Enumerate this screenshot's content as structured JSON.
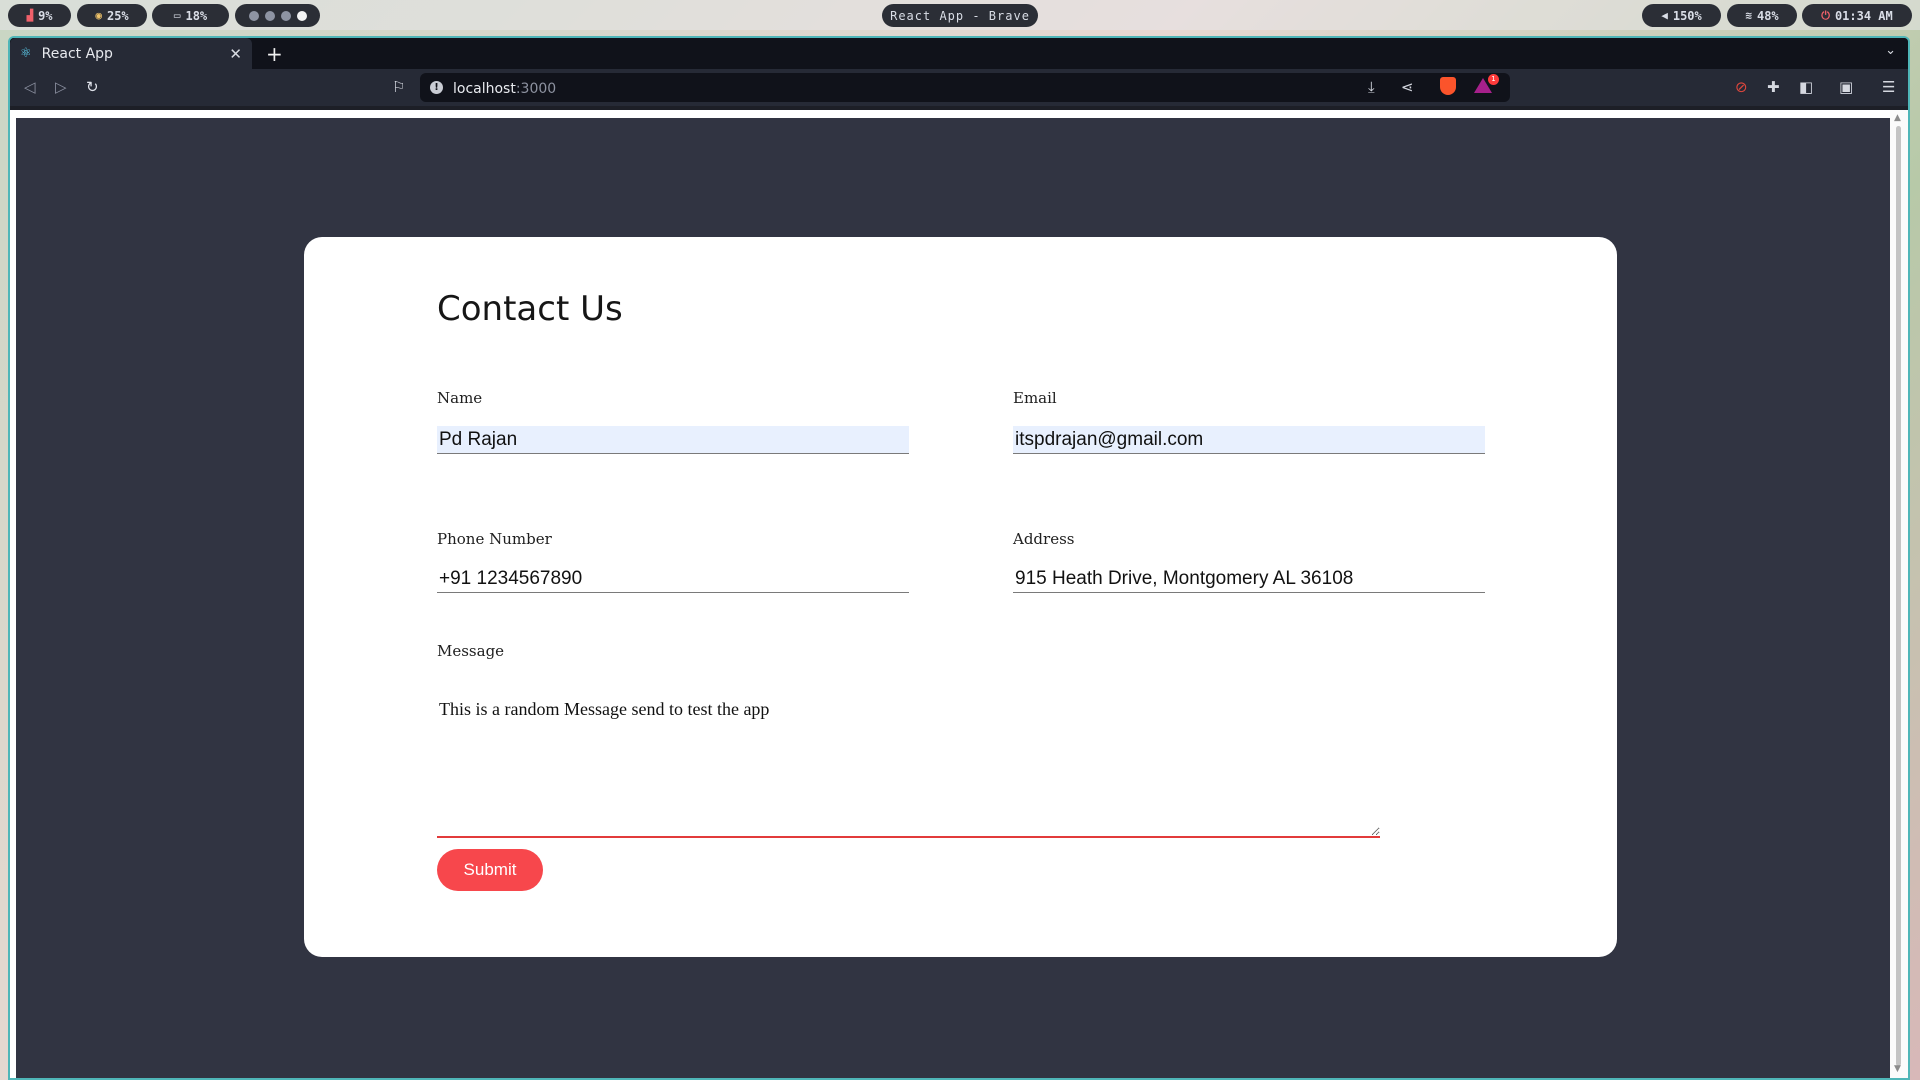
{
  "system_bar": {
    "cpu": "9%",
    "memory": "25%",
    "disk": "18%",
    "workspaces": [
      false,
      false,
      false,
      true
    ],
    "window_title": "React App - Brave",
    "volume": "150%",
    "wifi": "48%",
    "clock": "01:34 AM"
  },
  "browser": {
    "tab": {
      "title": "React App"
    },
    "address": {
      "host": "localhost",
      "port": ":3000"
    },
    "rewards_badge": "1"
  },
  "form": {
    "title": "Contact Us",
    "name": {
      "label": "Name",
      "value": "Pd Rajan"
    },
    "email": {
      "label": "Email",
      "value": "itspdrajan@gmail.com"
    },
    "phone": {
      "label": "Phone Number",
      "value": "+91 1234567890"
    },
    "address": {
      "label": "Address",
      "value": "915 Heath Drive, Montgomery AL 36108"
    },
    "message": {
      "label": "Message",
      "value": "This is a random Message send to test the app"
    },
    "submit_label": "Submit"
  },
  "colors": {
    "page_bg": "#313442",
    "card_bg": "#ffffff",
    "submit_bg": "#f7474c",
    "message_underline": "#e23b3b",
    "autofill_bg": "#e8f0fe",
    "window_border": "#4fb6b8"
  },
  "icons": {
    "cpu": "chart-icon",
    "memory": "cpu-chip-icon",
    "disk": "battery-icon",
    "volume": "speaker-icon",
    "wifi": "wifi-icon",
    "clock": "power-icon"
  }
}
